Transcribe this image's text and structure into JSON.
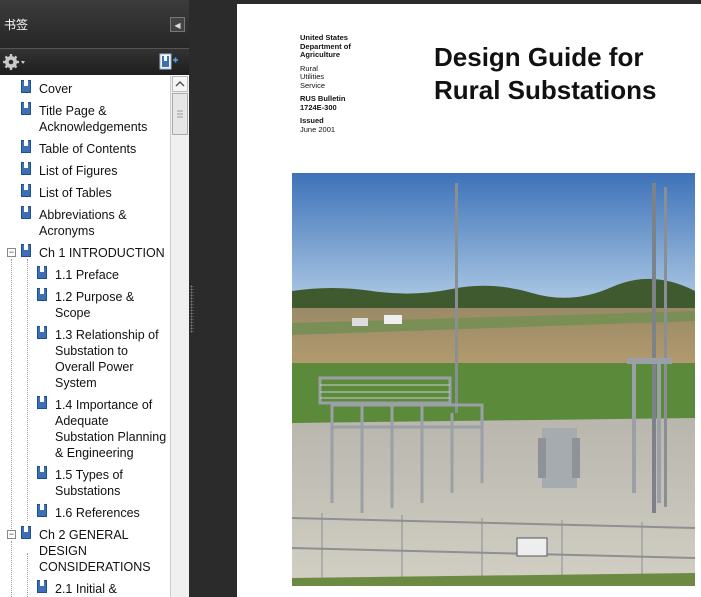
{
  "sidebar": {
    "title": "书签",
    "bookmarks": [
      {
        "label": "Cover",
        "level": 0
      },
      {
        "label": "Title Page &",
        "label2": "Acknowledgements",
        "level": 0
      },
      {
        "label": "Table of Contents",
        "level": 0
      },
      {
        "label": "List of Figures",
        "level": 0
      },
      {
        "label": "List of Tables",
        "level": 0
      },
      {
        "label": "Abbreviations &",
        "label2": "Acronyms",
        "level": 0
      },
      {
        "label": "Ch 1 INTRODUCTION",
        "level": 0,
        "expanded": true
      },
      {
        "label": "1.1 Preface",
        "level": 1
      },
      {
        "label": "1.2 Purpose &",
        "label2": "Scope",
        "level": 1
      },
      {
        "label": "1.3 Relationship of",
        "label2": "Substation to",
        "label3": "Overall Power",
        "label4": "System",
        "level": 1
      },
      {
        "label": "1.4 Importance of",
        "label2": "Adequate",
        "label3": "Substation Planning",
        "label4": "& Engineering",
        "level": 1
      },
      {
        "label": "1.5 Types of",
        "label2": "Substations",
        "level": 1
      },
      {
        "label": "1.6 References",
        "level": 1
      },
      {
        "label": "Ch 2 GENERAL",
        "label2": "DESIGN",
        "label3": "CONSIDERATIONS",
        "level": 0,
        "expanded": true
      },
      {
        "label": "2.1 Initial &",
        "level": 1
      }
    ]
  },
  "document": {
    "agency": {
      "line1": "United States",
      "line2": "Department of",
      "line3": "Agriculture",
      "line4": "Rural",
      "line5": "Utilities",
      "line6": "Service",
      "bulletin1": "RUS Bulletin",
      "bulletin2": "1724E-300",
      "issued_label": "Issued",
      "issued_date": "June 2001"
    },
    "title_line1": "Design Guide for",
    "title_line2": "Rural Substations"
  },
  "icons": {
    "gear": "gear-icon",
    "collapse": "collapse-panel-icon",
    "new_bookmark": "new-bookmark-icon",
    "bookmark": "bookmark-icon"
  },
  "colors": {
    "sidebar_header": "#2b2b2b",
    "bookmark_icon": "#3c6fb6",
    "viewer_bg": "#2b2b2b"
  }
}
